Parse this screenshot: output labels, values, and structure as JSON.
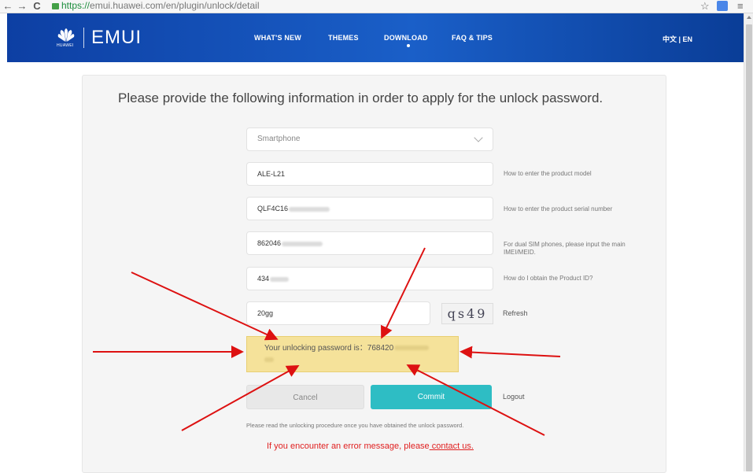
{
  "browser": {
    "url_scheme": "https://",
    "url_rest": "emui.huawei.com/en/plugin/unlock/detail",
    "back_icon": "←",
    "forward_icon": "→",
    "reload_icon": "C",
    "star_icon": "☆",
    "menu_icon": "≡"
  },
  "header": {
    "logo_sub": "HUAWEI",
    "logo_text": "EMUI",
    "nav": [
      "WHAT'S NEW",
      "THEMES",
      "DOWNLOAD",
      "FAQ & TIPS"
    ],
    "lang": "中文 | EN"
  },
  "form": {
    "title": "Please provide the following information in order to apply for the unlock password.",
    "device_type": "Smartphone",
    "model": "ALE-L21",
    "model_hint": "How to enter the product model",
    "serial": "QLF4C16",
    "serial_hint": "How to enter the product serial number",
    "imei": "862046",
    "imei_hint": "For dual SIM phones, please input the main IMEI/MEID.",
    "product_id": "434",
    "product_id_hint": "How do I obtain the Product ID?",
    "captcha_value": "20gg",
    "captcha_image_text": "qs49",
    "refresh_label": "Refresh",
    "result_text": "Your unlocking password is：768420",
    "cancel_label": "Cancel",
    "commit_label": "Commit",
    "logout_label": "Logout",
    "note": "Please read the unlocking procedure once you have obtained the unlock password.",
    "error_text": "If you encounter an error message, please",
    "error_link": " contact us."
  },
  "colors": {
    "header_blue": "#1a5fc8",
    "commit_teal": "#2ebdc4",
    "result_yellow": "#f5e29a",
    "error_red": "#e02020",
    "annotation_arrow": "#dd1111"
  }
}
